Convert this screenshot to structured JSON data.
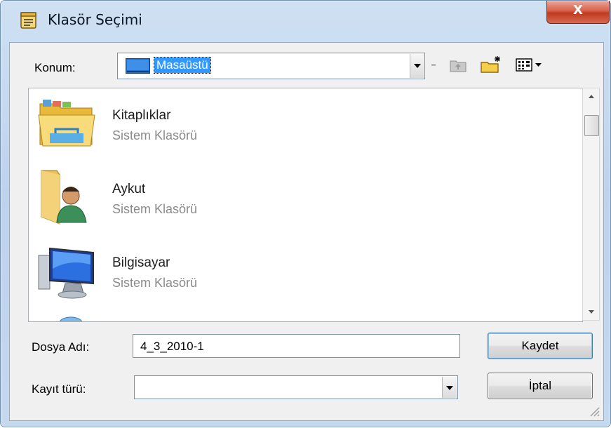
{
  "window": {
    "title": "Klasör Seçimi",
    "close_label": "X"
  },
  "location": {
    "label": "Konum:",
    "value": "Masaüstü"
  },
  "toolbar": {
    "icons": [
      "up-folder-icon",
      "new-folder-icon",
      "view-menu-icon"
    ]
  },
  "files": [
    {
      "name": "Kitaplıklar",
      "type": "Sistem Klasörü",
      "icon": "libraries-folder-icon"
    },
    {
      "name": "Aykut",
      "type": "Sistem Klasörü",
      "icon": "user-folder-icon"
    },
    {
      "name": "Bilgisayar",
      "type": "Sistem Klasörü",
      "icon": "computer-icon"
    }
  ],
  "filename": {
    "label": "Dosya Adı:",
    "value": "4_3_2010-1"
  },
  "filetype": {
    "label": "Kayıt türü:",
    "value": ""
  },
  "buttons": {
    "save": "Kaydet",
    "cancel": "İptal"
  },
  "colors": {
    "selection": "#3399ff",
    "close_button": "#c9452c",
    "frame": "#c4d8ee"
  }
}
